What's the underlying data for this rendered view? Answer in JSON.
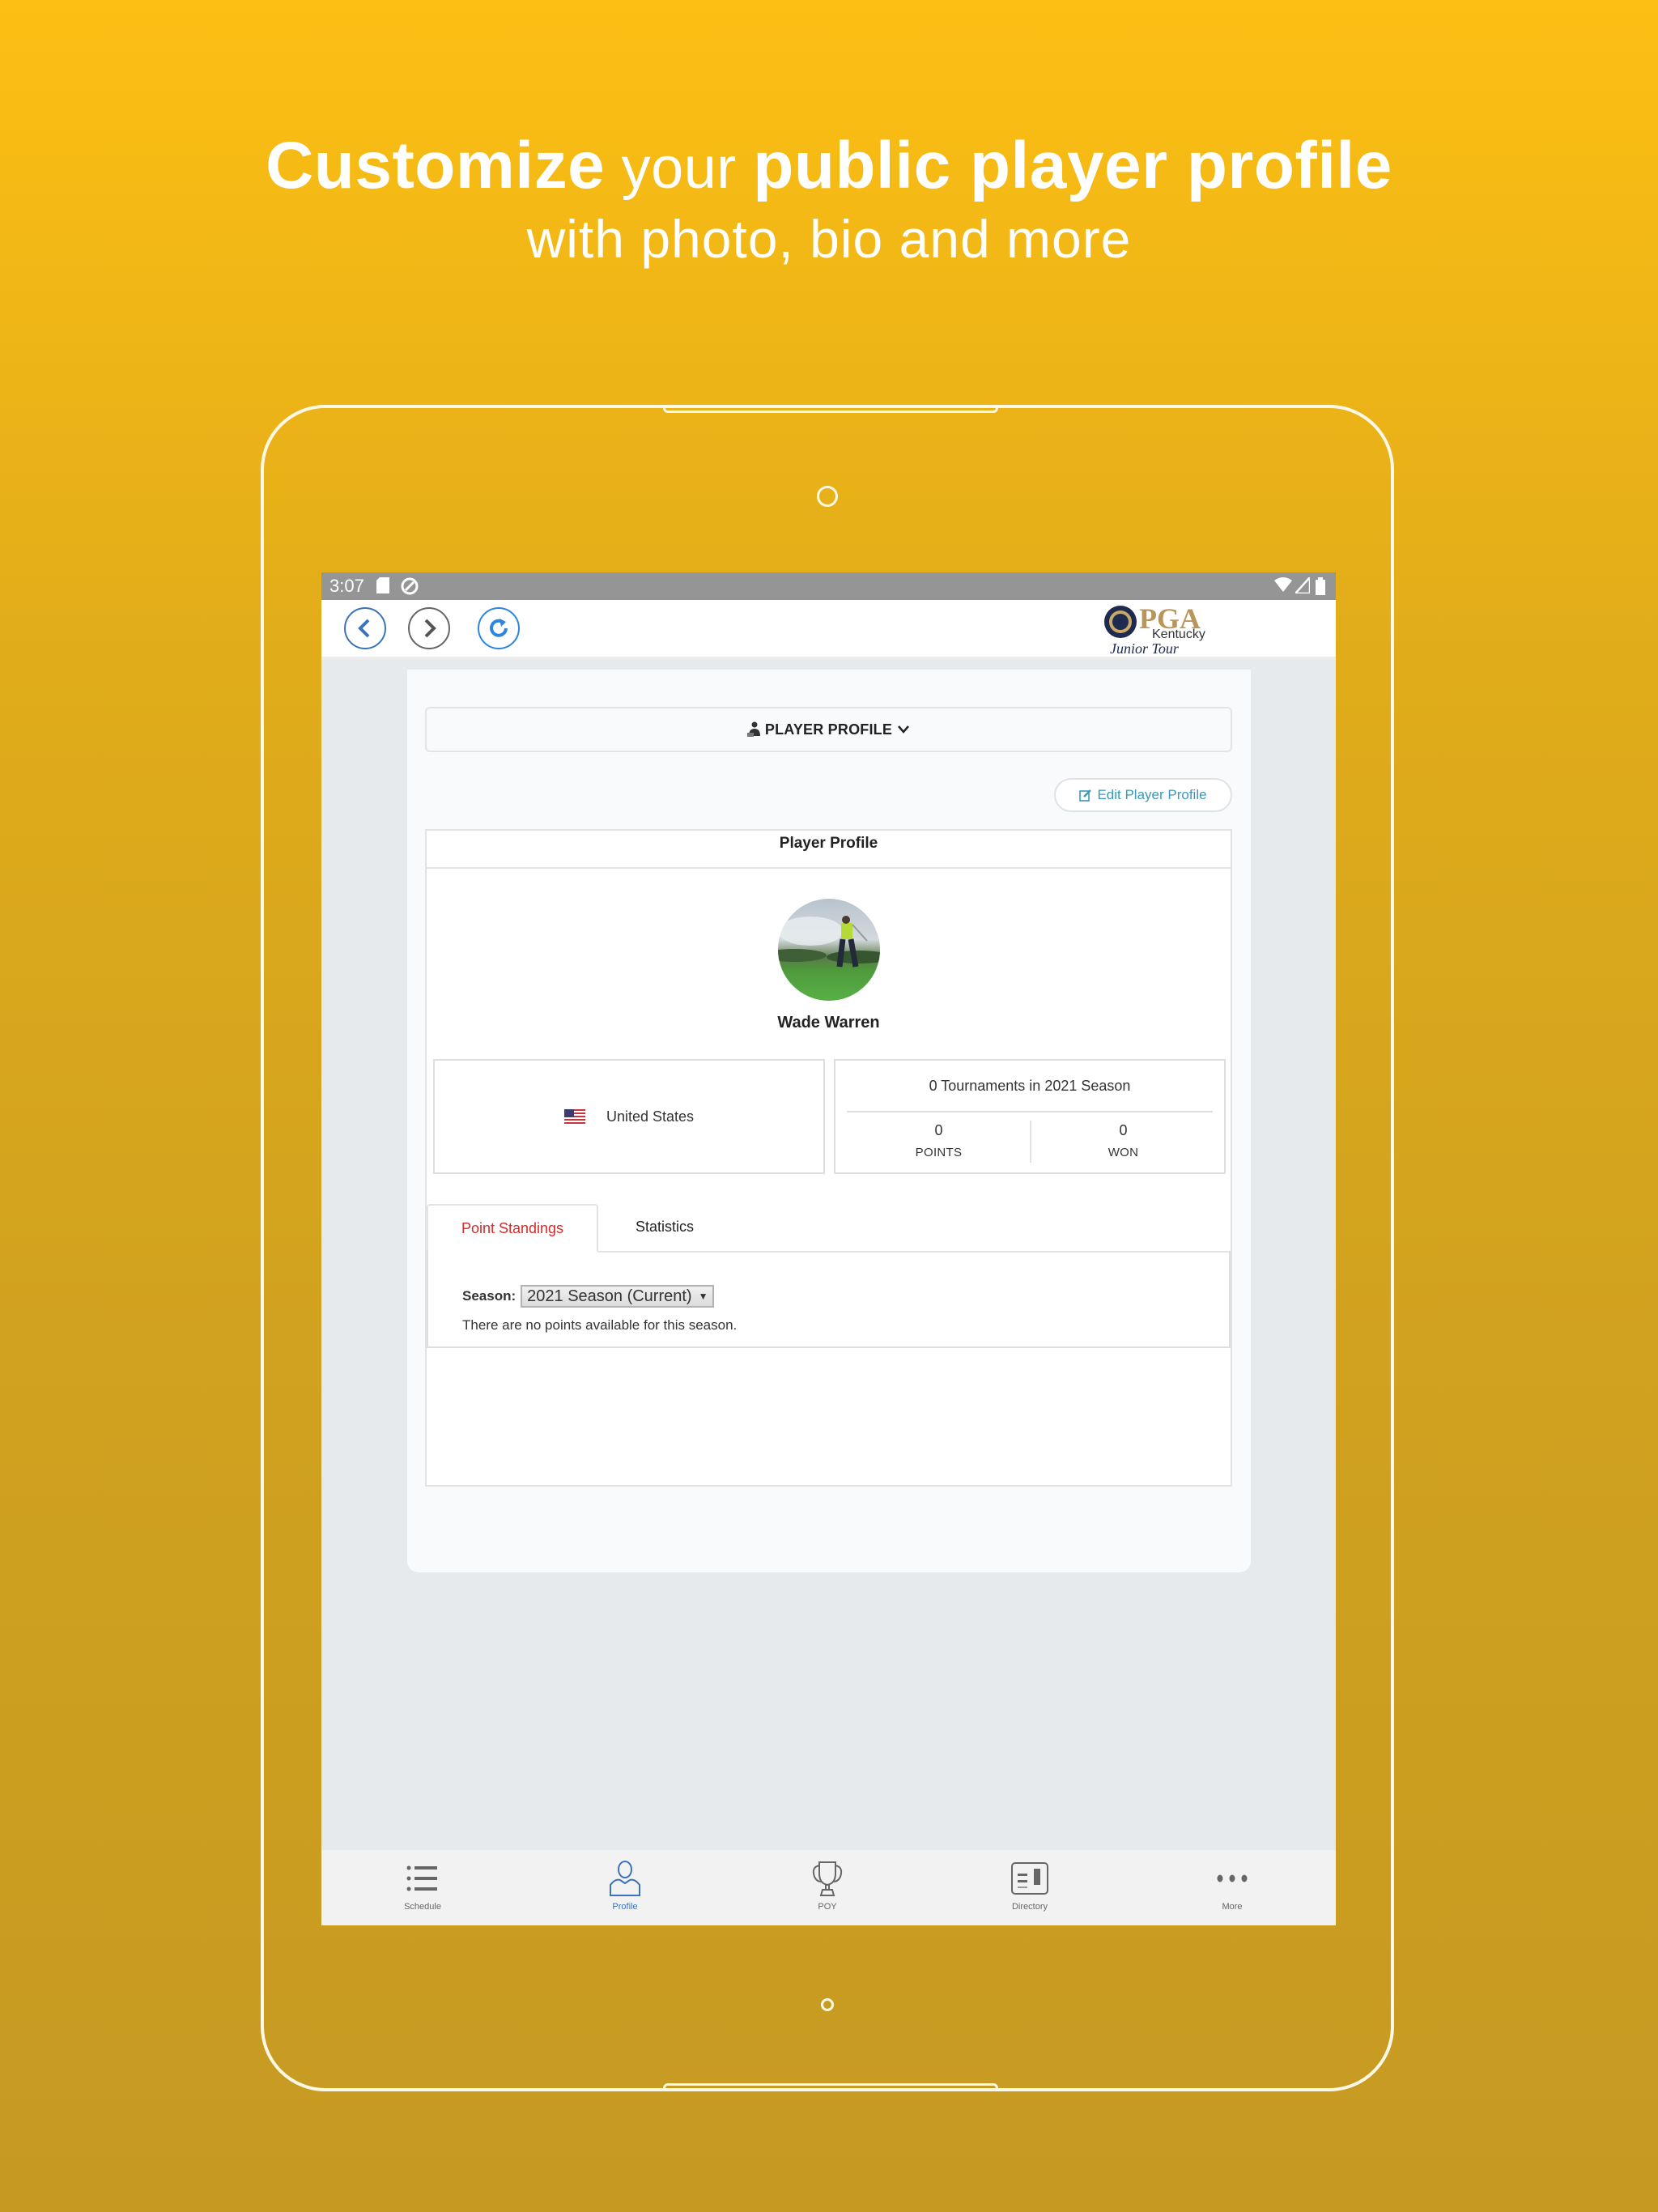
{
  "promo": {
    "line1": [
      {
        "text": "Customize",
        "weight": "bold"
      },
      {
        "text": " your ",
        "weight": "light"
      },
      {
        "text": "public player profile",
        "weight": "bold"
      }
    ],
    "line2": "with photo, bio and more"
  },
  "statusbar": {
    "time": "3:07",
    "left_icons": [
      "sd-card-icon",
      "sync-icon"
    ],
    "right_icons": [
      "wifi-icon",
      "signal-icon",
      "battery-icon"
    ]
  },
  "header": {
    "back_icon": "chevron-left-icon",
    "forward_icon": "chevron-right-icon",
    "refresh_icon": "refresh-icon",
    "logo": {
      "brand": "PGA",
      "region": "Kentucky",
      "tagline": "Junior Tour"
    }
  },
  "page": {
    "section_dropdown_label": "PLAYER PROFILE",
    "edit_button_label": "Edit Player Profile",
    "card_title": "Player Profile",
    "player_name": "Wade Warren",
    "country": "United States",
    "tournaments_line": "0 Tournaments in 2021 Season",
    "stats": [
      {
        "value": "0",
        "label": "POINTS"
      },
      {
        "value": "0",
        "label": "WON"
      }
    ],
    "tabs": [
      {
        "label": "Point Standings",
        "active": true
      },
      {
        "label": "Statistics",
        "active": false
      }
    ],
    "season_label": "Season:",
    "season_selected": "2021 Season (Current)",
    "empty_message": "There are no points available for this season."
  },
  "bottom_nav": [
    {
      "label": "Schedule",
      "icon": "list-icon",
      "active": false
    },
    {
      "label": "Profile",
      "icon": "person-icon",
      "active": true
    },
    {
      "label": "POY",
      "icon": "trophy-icon",
      "active": false
    },
    {
      "label": "Directory",
      "icon": "directory-icon",
      "active": false
    },
    {
      "label": "More",
      "icon": "more-icon",
      "active": false
    }
  ],
  "colors": {
    "accent_blue": "#3a73b8",
    "active_tab_red": "#d42b2b",
    "edit_link": "#3a9ab5",
    "brand_gold": "#fdbf13"
  }
}
